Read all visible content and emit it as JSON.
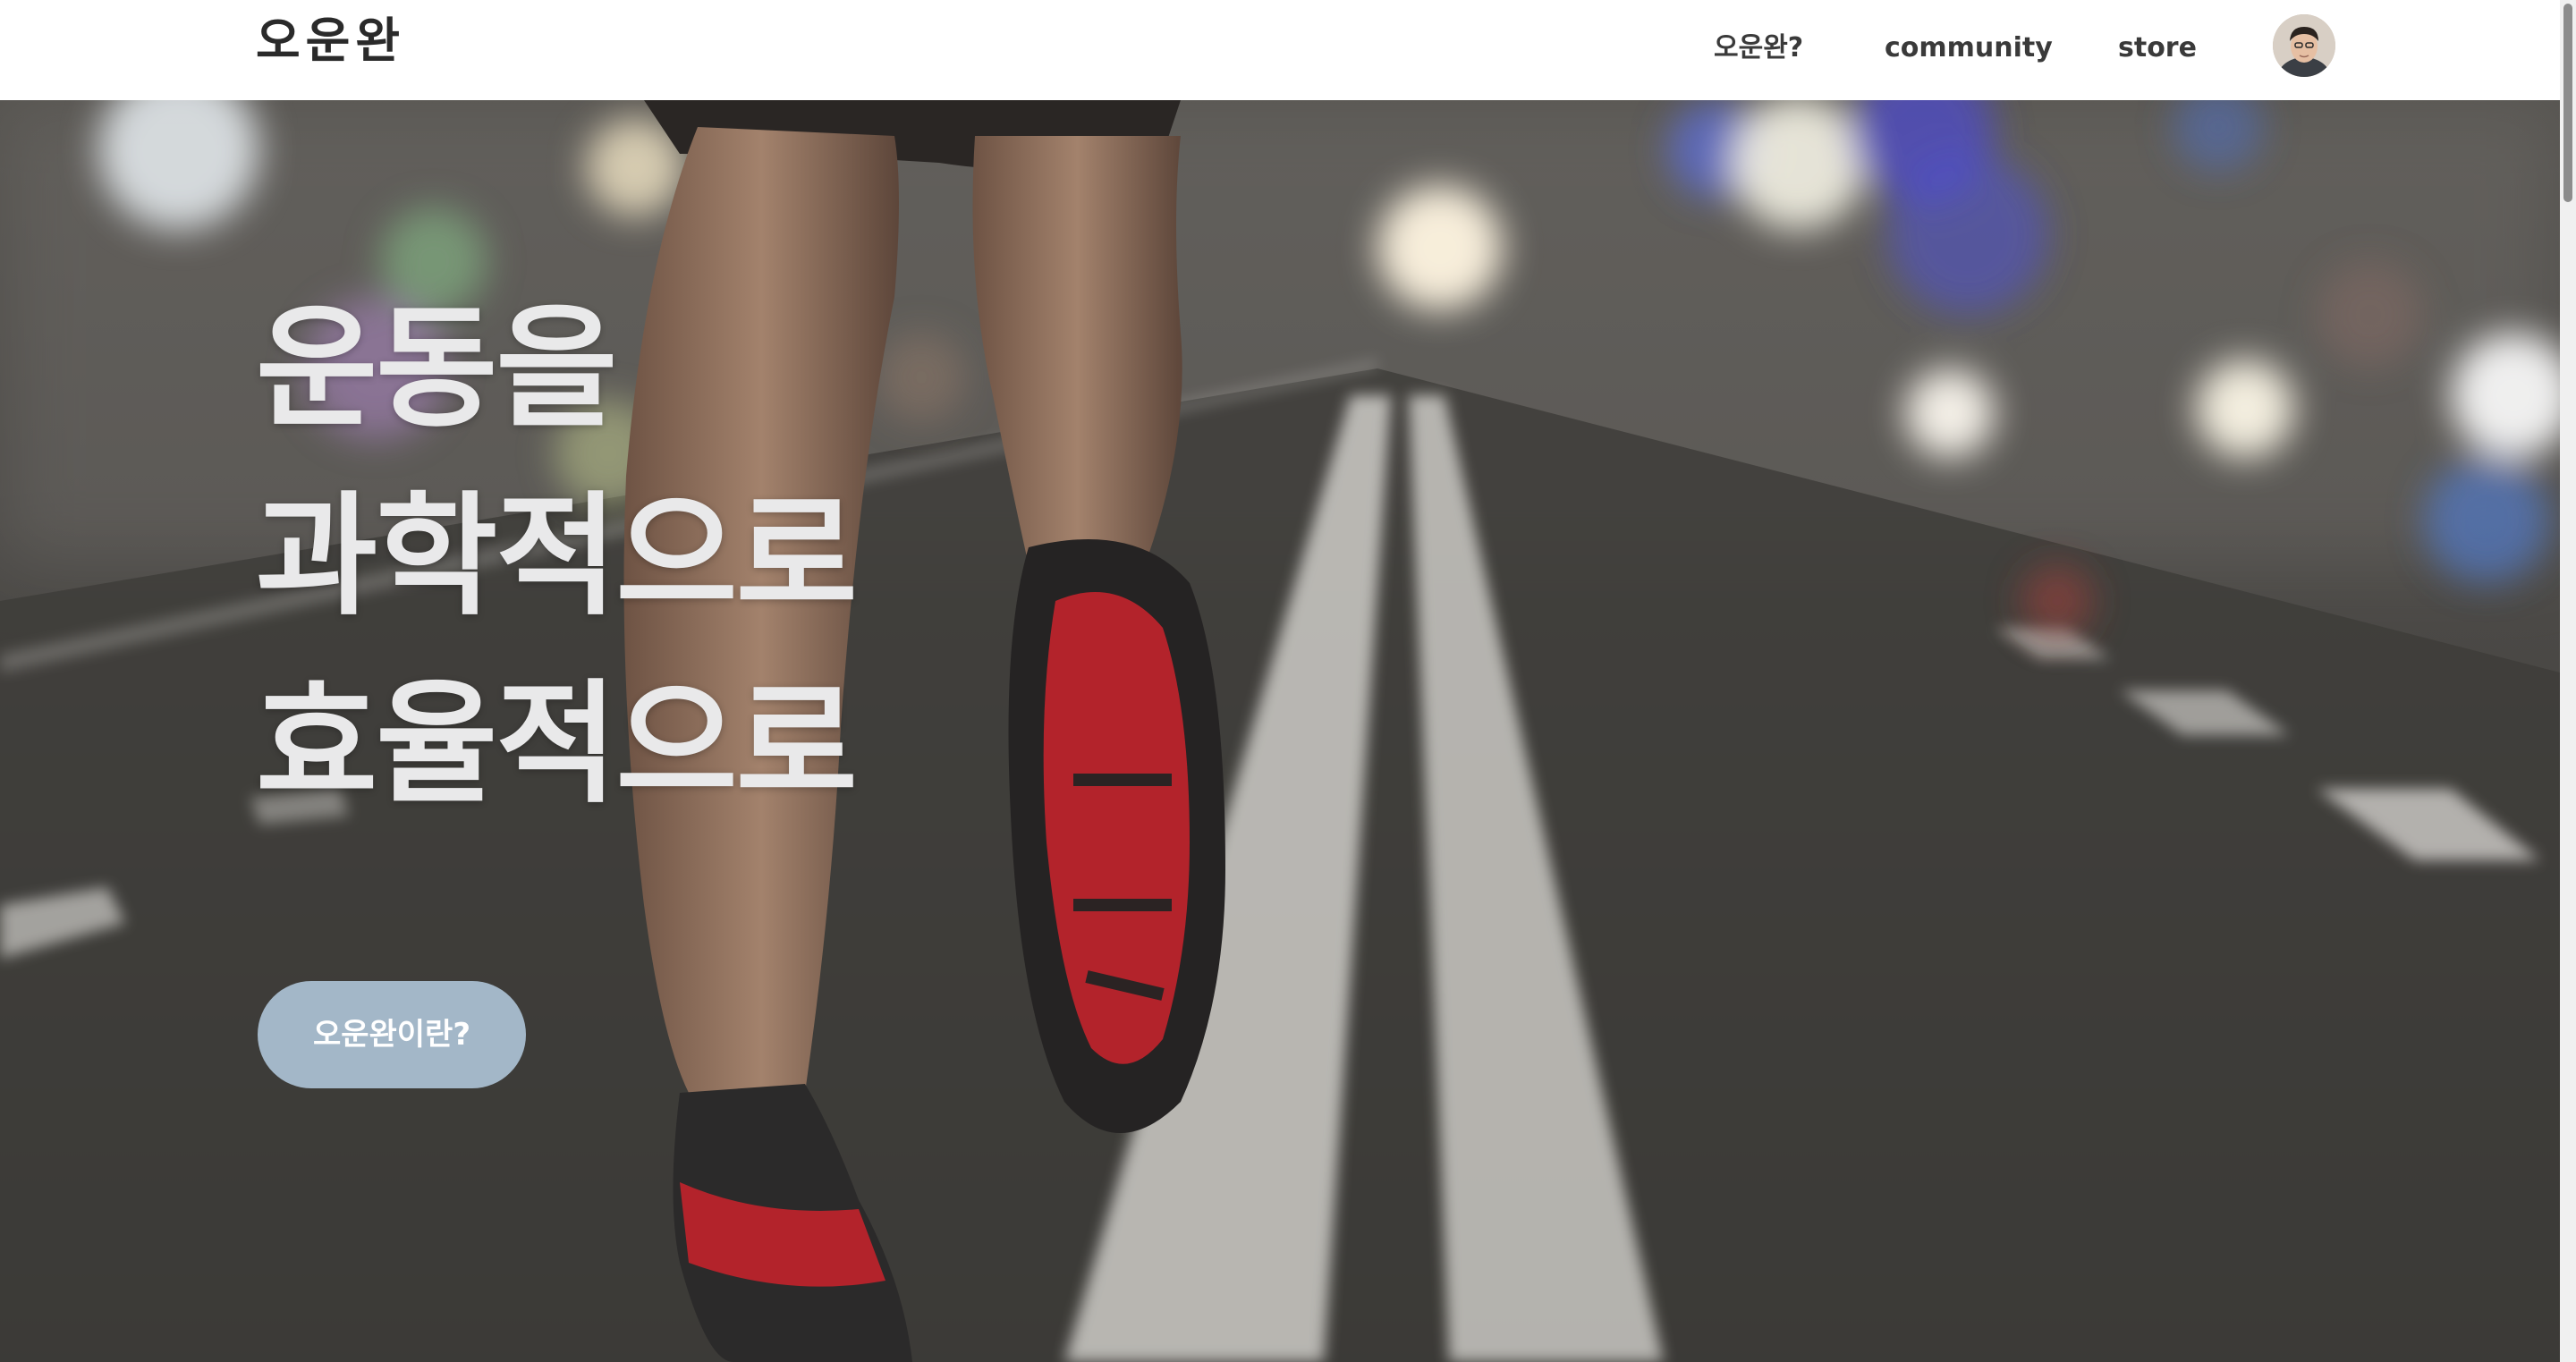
{
  "brand": {
    "logo": "오운완"
  },
  "nav": {
    "about_label": "오운완?",
    "community_label": "community",
    "store_label": "store",
    "avatar_icon": "user-avatar-icon"
  },
  "hero": {
    "headline_lines": [
      "운동을",
      "과학적으로",
      "효율적으로"
    ],
    "cta_label": "오운완이란?",
    "background": "running-track-photo"
  },
  "colors": {
    "nav_background": "#ffffff",
    "cta_background": "#a3b7c8",
    "headline_text": "#e9e9ea",
    "shoe_accent": "#b3232b"
  }
}
